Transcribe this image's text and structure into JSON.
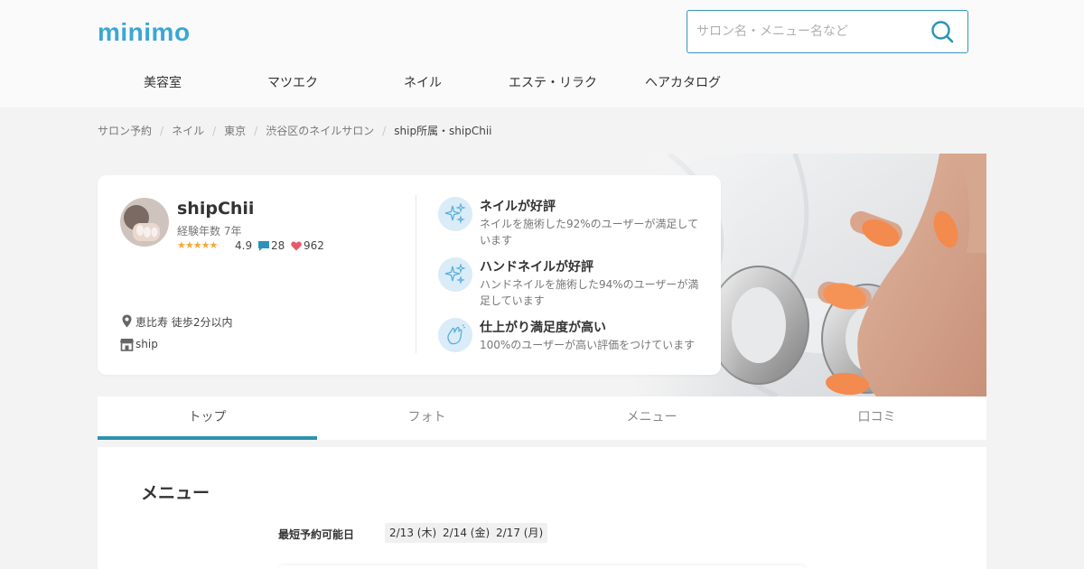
{
  "header": {
    "logo": "minimo",
    "search_placeholder": "サロン名・メニュー名など",
    "search_value": ""
  },
  "nav": [
    "美容室",
    "マツエク",
    "ネイル",
    "エステ・リラク",
    "ヘアカタログ"
  ],
  "breadcrumb": [
    "サロン予約",
    "ネイル",
    "東京",
    "渋谷区のネイルサロン",
    "ship所属・shipChii"
  ],
  "profile": {
    "name": "shipChii",
    "experience": "経験年数 7年",
    "stars": "★★★★★",
    "rating": "4.9",
    "reviews": "28",
    "favorites": "962",
    "location": "恵比寿 徒歩2分以内",
    "shop": "ship"
  },
  "features": [
    {
      "title": "ネイルが好評",
      "desc": "ネイルを施術した92%のユーザーが満足しています",
      "icon": "sparkle-icon"
    },
    {
      "title": "ハンドネイルが好評",
      "desc": "ハンドネイルを施術した94%のユーザーが満足しています",
      "icon": "sparkle-icon"
    },
    {
      "title": "仕上がり満足度が高い",
      "desc": "100%のユーザーが高い評価をつけています",
      "icon": "clap-icon"
    }
  ],
  "tabs": [
    "トップ",
    "フォト",
    "メニュー",
    "口コミ"
  ],
  "active_tab": "トップ",
  "menu": {
    "title": "メニュー",
    "earliest_label": "最短予約可能日",
    "dates": [
      "2/13 (木)",
      "2/14 (金)",
      "2/17 (月)"
    ]
  },
  "colors": {
    "brand": "#3ba6d6",
    "accent": "#2b93b6",
    "star": "#f3a93c",
    "heart": "#e8586a",
    "comment": "#2b93b6",
    "feature_bg": "#d9ecf7"
  }
}
